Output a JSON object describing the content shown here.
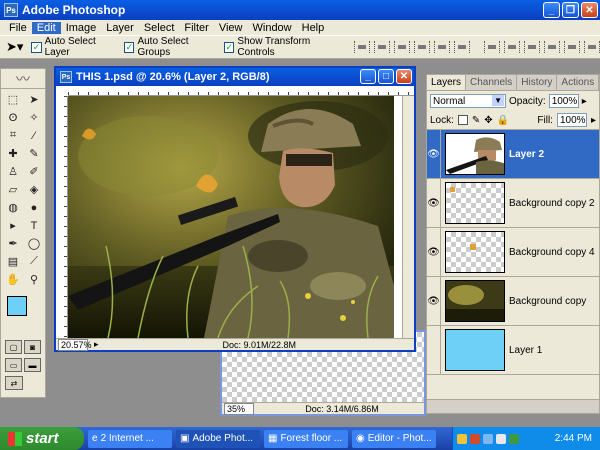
{
  "app": {
    "title": "Adobe Photoshop"
  },
  "menu": [
    "File",
    "Edit",
    "Image",
    "Layer",
    "Select",
    "Filter",
    "View",
    "Window",
    "Help"
  ],
  "menu_active": "Edit",
  "options": {
    "auto_select_layer": "Auto Select Layer",
    "auto_select_groups": "Auto Select Groups",
    "show_transform_controls": "Show Transform Controls"
  },
  "doc_front": {
    "title": "THIS 1.psd @ 20.6% (Layer 2, RGB/8)",
    "zoom": "20.57%",
    "doc_size": "Doc: 9.01M/22.8M"
  },
  "doc_back": {
    "zoom": "35%",
    "doc_size": "Doc: 3.14M/6.86M"
  },
  "layers_panel": {
    "tabs": [
      "Layers",
      "Channels",
      "History",
      "Actions"
    ],
    "blend_mode": "Normal",
    "opacity_label": "Opacity:",
    "opacity_value": "100%",
    "lock_label": "Lock:",
    "fill_label": "Fill:",
    "fill_value": "100%",
    "layers": [
      {
        "name": "Layer 2",
        "visible": true,
        "selected": true
      },
      {
        "name": "Background copy 2",
        "visible": true,
        "selected": false
      },
      {
        "name": "Background copy 4",
        "visible": true,
        "selected": false
      },
      {
        "name": "Background copy",
        "visible": true,
        "selected": false
      },
      {
        "name": "Layer 1",
        "visible": false,
        "selected": false
      }
    ]
  },
  "taskbar": {
    "start": "start",
    "items": [
      "2 Internet ...",
      "Adobe Phot...",
      "Forest floor ...",
      "Editor - Phot..."
    ],
    "clock": "2:44 PM"
  },
  "colors": {
    "foreground": "#6ed0f6",
    "background": "#ffffff",
    "layer1_fill": "#6ed0f6"
  }
}
